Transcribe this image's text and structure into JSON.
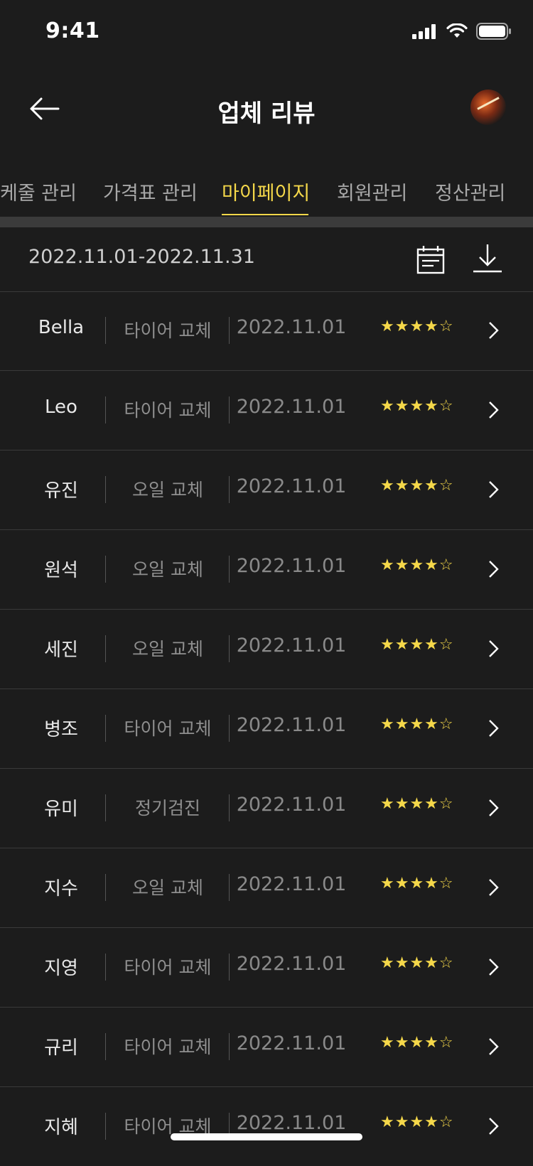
{
  "status_bar": {
    "time": "9:41"
  },
  "header": {
    "title": "업체 리뷰"
  },
  "tabs": [
    {
      "label": "케줄 관리",
      "active": false
    },
    {
      "label": "가격표 관리",
      "active": false
    },
    {
      "label": "마이페이지",
      "active": true
    },
    {
      "label": "회원관리",
      "active": false
    },
    {
      "label": "정산관리",
      "active": false
    }
  ],
  "filter": {
    "date_range": "2022.11.01-2022.11.31"
  },
  "reviews": [
    {
      "name": "Bella",
      "service": "타이어 교체",
      "date": "2022.11.01",
      "stars": "★★★★☆",
      "rating": 4
    },
    {
      "name": "Leo",
      "service": "타이어 교체",
      "date": "2022.11.01",
      "stars": "★★★★☆",
      "rating": 4
    },
    {
      "name": "유진",
      "service": "오일 교체",
      "date": "2022.11.01",
      "stars": "★★★★☆",
      "rating": 4
    },
    {
      "name": "원석",
      "service": "오일 교체",
      "date": "2022.11.01",
      "stars": "★★★★☆",
      "rating": 4
    },
    {
      "name": "세진",
      "service": "오일 교체",
      "date": "2022.11.01",
      "stars": "★★★★☆",
      "rating": 4
    },
    {
      "name": "병조",
      "service": "타이어 교체",
      "date": "2022.11.01",
      "stars": "★★★★☆",
      "rating": 4
    },
    {
      "name": "유미",
      "service": "정기검진",
      "date": "2022.11.01",
      "stars": "★★★★☆",
      "rating": 4
    },
    {
      "name": "지수",
      "service": "오일 교체",
      "date": "2022.11.01",
      "stars": "★★★★☆",
      "rating": 4
    },
    {
      "name": "지영",
      "service": "타이어 교체",
      "date": "2022.11.01",
      "stars": "★★★★☆",
      "rating": 4
    },
    {
      "name": "규리",
      "service": "타이어 교체",
      "date": "2022.11.01",
      "stars": "★★★★☆",
      "rating": 4
    },
    {
      "name": "지혜",
      "service": "타이어 교체",
      "date": "2022.11.01",
      "stars": "★★★★☆",
      "rating": 4
    }
  ],
  "colors": {
    "background": "#1c1c1c",
    "accent": "#f5d84a",
    "muted_text": "#8a8a8a"
  },
  "icons": [
    "back-arrow-icon",
    "avatar",
    "calendar-icon",
    "download-icon",
    "chevron-right-icon",
    "signal-icon",
    "wifi-icon",
    "battery-icon"
  ]
}
